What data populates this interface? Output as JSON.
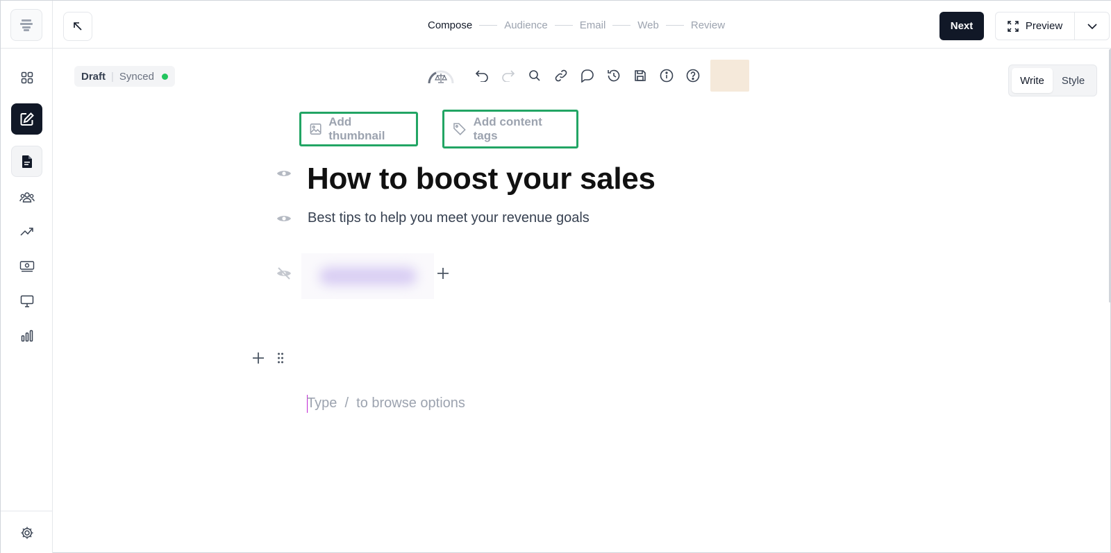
{
  "topbar": {
    "steps": [
      "Compose",
      "Audience",
      "Email",
      "Web",
      "Review"
    ],
    "current_step": "Compose",
    "next_label": "Next",
    "preview_label": "Preview"
  },
  "status": {
    "draft_label": "Draft",
    "synced_label": "Synced",
    "synced_color": "#22c55e"
  },
  "toolbar": {
    "icons": [
      "gauge-icon",
      "undo-icon",
      "redo-icon",
      "search-icon",
      "link-icon",
      "comment-icon",
      "history-icon",
      "save-icon",
      "info-icon",
      "help-icon"
    ]
  },
  "mode": {
    "write_label": "Write",
    "style_label": "Style",
    "active": "Write"
  },
  "meta": {
    "thumbnail_label": "Add thumbnail",
    "tags_label": "Add content tags",
    "highlight_color": "#22a564"
  },
  "post": {
    "title": "How to boost your sales",
    "subtitle": "Best tips to help you meet your revenue goals"
  },
  "editor": {
    "placeholder": "Type  /  to browse options"
  },
  "sidebar": {
    "items": [
      "dashboard-icon",
      "compose-icon",
      "posts-icon",
      "audience-icon",
      "growth-icon",
      "monetize-icon",
      "website-icon",
      "analytics-icon",
      "settings-icon"
    ],
    "active": "compose-icon"
  }
}
